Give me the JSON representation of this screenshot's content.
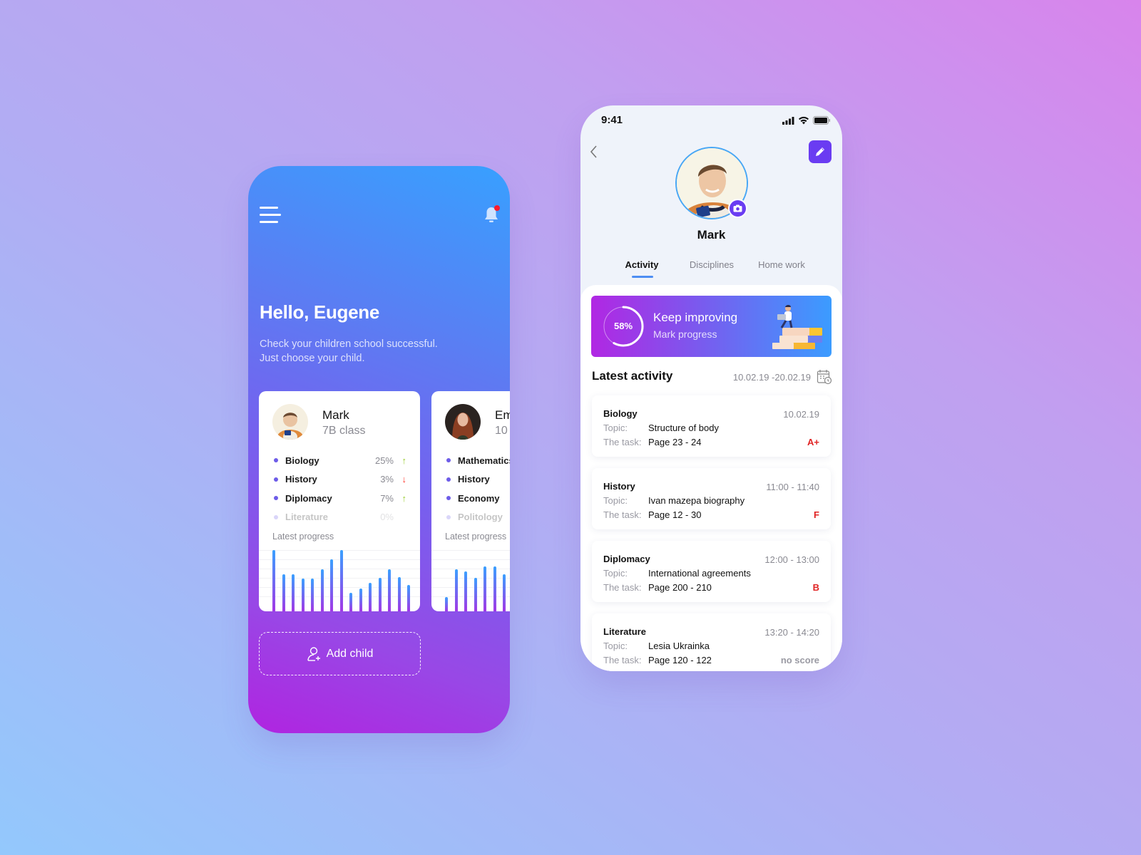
{
  "dashboard": {
    "greeting": "Hello, Eugene",
    "subtitle_line1": "Check your children school successful.",
    "subtitle_line2": "Just choose your child.",
    "notification_badge": true,
    "progress_label": "Latest progress",
    "add_child_label": "Add child",
    "children": [
      {
        "name": "Mark",
        "class": "7B class",
        "subjects": [
          {
            "name": "Biology",
            "value": "25%",
            "trend": "up"
          },
          {
            "name": "History",
            "value": "3%",
            "trend": "down"
          },
          {
            "name": "Diplomacy",
            "value": "7%",
            "trend": "up"
          },
          {
            "name": "Literature",
            "value": "0%",
            "trend": "none"
          }
        ]
      },
      {
        "name": "Emma",
        "class": "10",
        "subjects": [
          {
            "name": "Mathematics",
            "value": "",
            "trend": "none"
          },
          {
            "name": "History",
            "value": "",
            "trend": "none"
          },
          {
            "name": "Economy",
            "value": "",
            "trend": "none"
          },
          {
            "name": "Politology",
            "value": "",
            "trend": "none"
          }
        ]
      }
    ]
  },
  "chart_data": [
    {
      "type": "bar",
      "title": "Latest progress",
      "series": [
        {
          "name": "Mark",
          "values": [
            100,
            60,
            60,
            53,
            53,
            69,
            85,
            100,
            30,
            37,
            47,
            55,
            69,
            56,
            43
          ]
        }
      ],
      "ylim": [
        0,
        100
      ],
      "grid": true
    },
    {
      "type": "bar",
      "title": "Latest progress",
      "series": [
        {
          "name": "Emma",
          "values": [
            23,
            69,
            65,
            55,
            73,
            73,
            60
          ]
        }
      ],
      "ylim": [
        0,
        100
      ],
      "grid": true
    }
  ],
  "profile": {
    "status_time": "9:41",
    "name": "Mark",
    "tabs": [
      "Activity",
      "Disciplines",
      "Home work"
    ],
    "active_tab": "Activity",
    "banner": {
      "percent_label": "58%",
      "percent_value": 58,
      "title": "Keep improving",
      "subtitle": "Mark progress"
    },
    "latest_activity_title": "Latest activity",
    "date_range": "10.02.19 -20.02.19",
    "topic_label": "Topic:",
    "task_label": "The task:",
    "activities": [
      {
        "subject": "Biology",
        "time": "10.02.19",
        "topic": "Structure of body",
        "task": "Page 23 - 24",
        "grade": "A+"
      },
      {
        "subject": "History",
        "time": "11:00 - 11:40",
        "topic": "Ivan mazepa biography",
        "task": "Page 12 - 30",
        "grade": "F"
      },
      {
        "subject": "Diplomacy",
        "time": "12:00 - 13:00",
        "topic": "International agreements",
        "task": "Page 200 - 210",
        "grade": "B"
      },
      {
        "subject": "Literature",
        "time": "13:20 - 14:20",
        "topic": "Lesia Ukrainka",
        "task": "Page 120 - 122",
        "grade": "no score"
      }
    ]
  },
  "colors": {
    "accent_purple": "#6a3cf2",
    "accent_blue": "#3aa0ff",
    "grade_red": "#e02424",
    "trend_up": "#9acd32",
    "trend_down": "#ff3b30"
  }
}
